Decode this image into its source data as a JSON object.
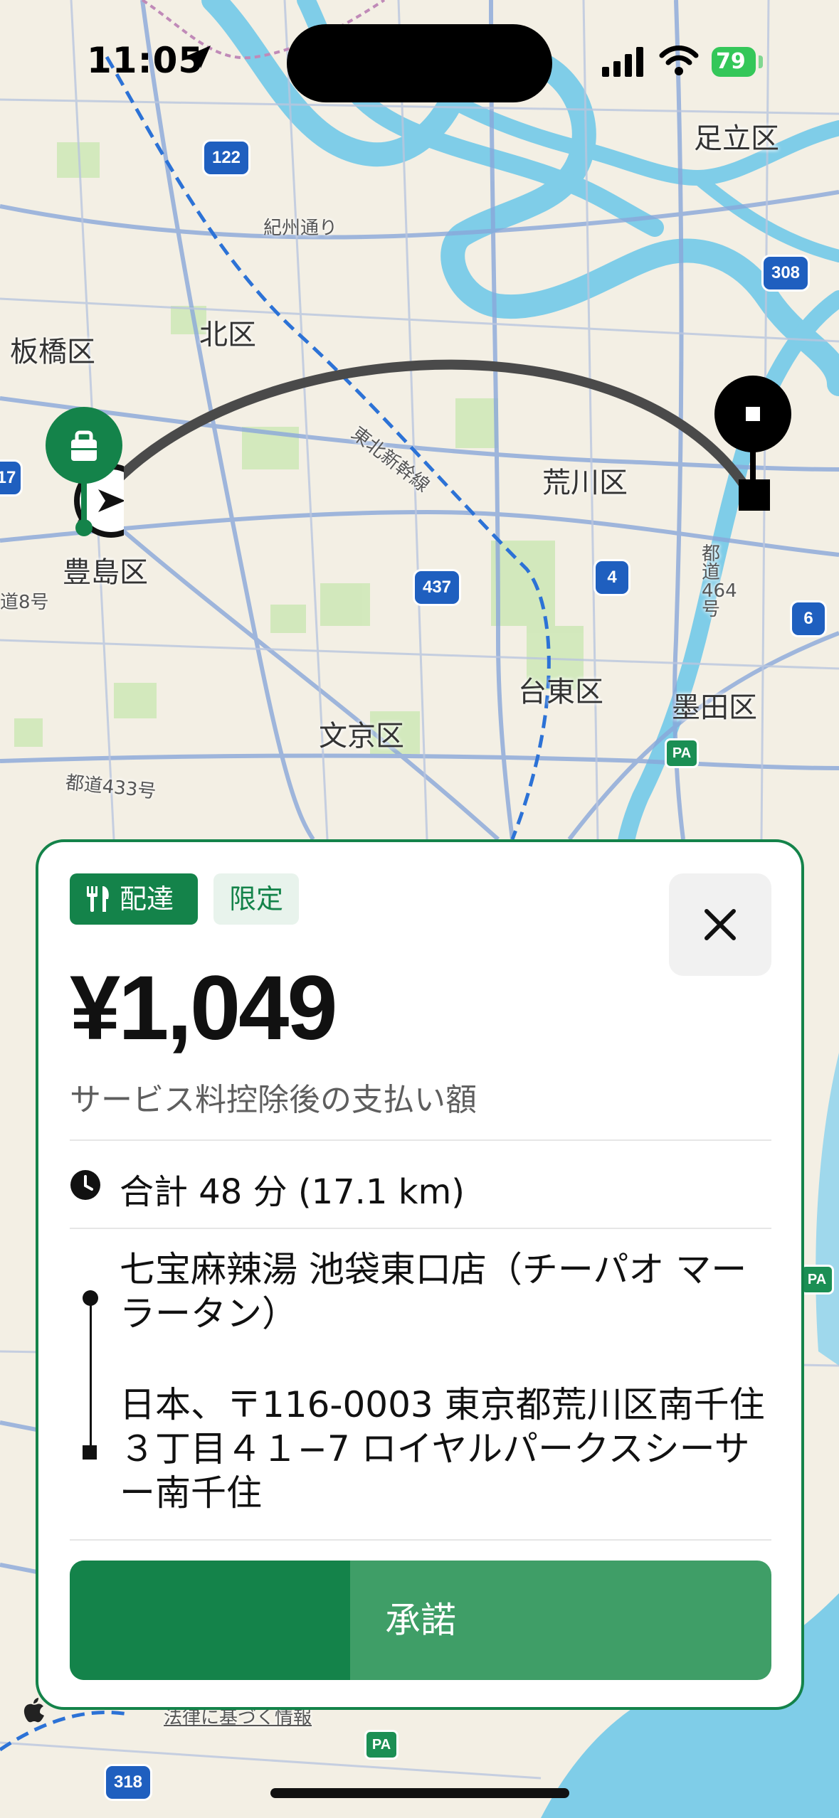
{
  "status_bar": {
    "time": "11:05",
    "battery": "79"
  },
  "map": {
    "labels": {
      "adachi": "足立区",
      "itabashi": "板橋区",
      "kita": "北区",
      "arakawa": "荒川区",
      "toshima": "豊島区",
      "taito": "台東区",
      "sumida": "墨田区",
      "bunkyo": "文京区",
      "kishu_dori": "紀州通り",
      "tohoku_shinkansen": "東北新幹線",
      "todo_433": "都道433号",
      "todo_464": "都道464号",
      "route_8": "道8号",
      "legal": "法律に基づく情報"
    },
    "shields": {
      "r122": "122",
      "r308": "308",
      "r437": "437",
      "r4": "4",
      "r6": "6",
      "r318": "318",
      "r17": "17",
      "pa": "PA"
    }
  },
  "offer": {
    "tag_delivery": "配達",
    "tag_limited": "限定",
    "price": "¥1,049",
    "price_subtitle": "サービス料控除後の支払い額",
    "duration": "合計 48 分 (17.1 km)",
    "pickup": "七宝麻辣湯 池袋東口店（チーパオ マーラータン）",
    "dropoff": "日本、〒116-0003 東京都荒川区南千住３丁目４１−7 ロイヤルパークスシーサー南千住",
    "accept_label": "承諾",
    "accept_progress": 0.4
  },
  "colors": {
    "brand_green": "#14834a",
    "accept_light": "#3f9e67"
  }
}
